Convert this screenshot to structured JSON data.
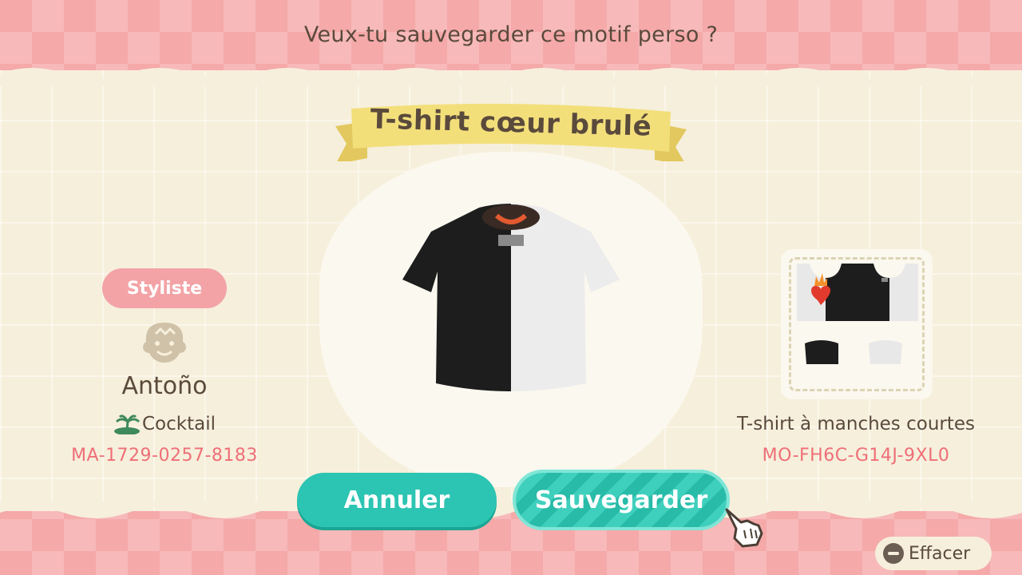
{
  "header": {
    "prompt": "Veux-tu sauvegarder ce motif perso ?"
  },
  "design": {
    "title": "T-shirt cœur brulé",
    "type": "T-shirt à manches courtes",
    "code": "MO-FH6C-G14J-9XL0"
  },
  "creator": {
    "role_label": "Styliste",
    "name": "Antoño",
    "island": "Cocktail",
    "code": "MA-1729-0257-8183"
  },
  "buttons": {
    "cancel_label": "Annuler",
    "save_label": "Sauvegarder",
    "erase_label": "Effacer"
  },
  "icons": {
    "avatar": "villager-face-icon",
    "island": "island-palm-icon",
    "cursor": "pointing-hand-cursor-icon",
    "erase": "minus-button-icon"
  },
  "colors": {
    "accent_teal": "#2cc4b2",
    "code_pink": "#ee6f78",
    "ribbon_yellow": "#f3df7a",
    "text_brown": "#5a4a3c"
  }
}
